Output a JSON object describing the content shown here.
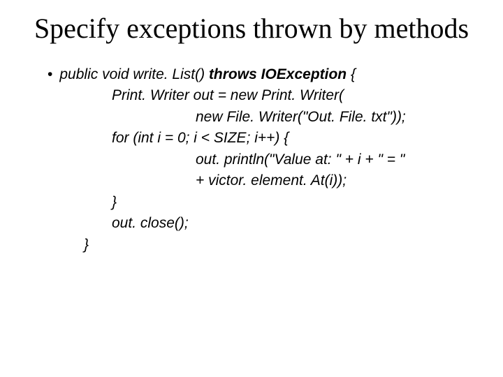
{
  "title": "Specify exceptions thrown by methods",
  "code": {
    "l1a": "public void write. List() ",
    "l1b": "throws IOException ",
    "l1c": "{",
    "l2": "Print. Writer out = new  Print. Writer(",
    "l3": "new File. Writer(\"Out. File. txt\"));",
    "l4": "for (int i = 0; i < SIZE; i++) {",
    "l5": "out. println(\"Value at: \" + i + \" = \"",
    "l6": "+ victor. element. At(i));",
    "l7": "}",
    "l8": "out. close();",
    "l9": "}"
  }
}
